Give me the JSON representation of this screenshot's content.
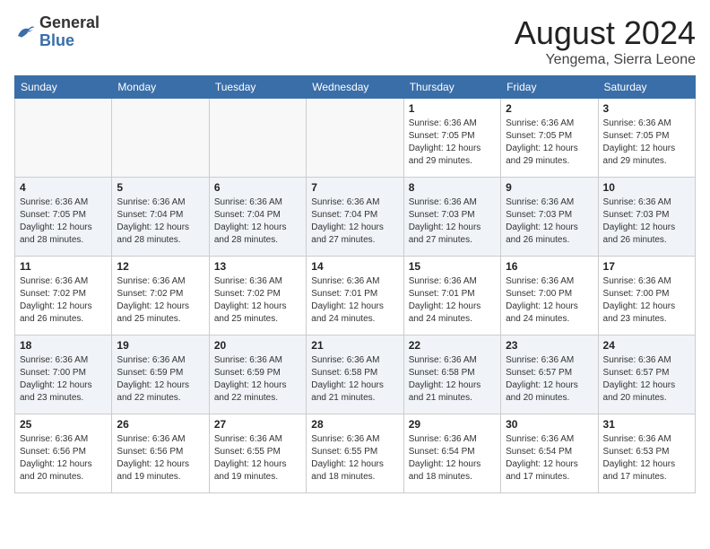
{
  "header": {
    "logo_general": "General",
    "logo_blue": "Blue",
    "month_title": "August 2024",
    "location": "Yengema, Sierra Leone"
  },
  "weekdays": [
    "Sunday",
    "Monday",
    "Tuesday",
    "Wednesday",
    "Thursday",
    "Friday",
    "Saturday"
  ],
  "weeks": [
    [
      {
        "day": "",
        "info": ""
      },
      {
        "day": "",
        "info": ""
      },
      {
        "day": "",
        "info": ""
      },
      {
        "day": "",
        "info": ""
      },
      {
        "day": "1",
        "info": "Sunrise: 6:36 AM\nSunset: 7:05 PM\nDaylight: 12 hours\nand 29 minutes."
      },
      {
        "day": "2",
        "info": "Sunrise: 6:36 AM\nSunset: 7:05 PM\nDaylight: 12 hours\nand 29 minutes."
      },
      {
        "day": "3",
        "info": "Sunrise: 6:36 AM\nSunset: 7:05 PM\nDaylight: 12 hours\nand 29 minutes."
      }
    ],
    [
      {
        "day": "4",
        "info": "Sunrise: 6:36 AM\nSunset: 7:05 PM\nDaylight: 12 hours\nand 28 minutes."
      },
      {
        "day": "5",
        "info": "Sunrise: 6:36 AM\nSunset: 7:04 PM\nDaylight: 12 hours\nand 28 minutes."
      },
      {
        "day": "6",
        "info": "Sunrise: 6:36 AM\nSunset: 7:04 PM\nDaylight: 12 hours\nand 28 minutes."
      },
      {
        "day": "7",
        "info": "Sunrise: 6:36 AM\nSunset: 7:04 PM\nDaylight: 12 hours\nand 27 minutes."
      },
      {
        "day": "8",
        "info": "Sunrise: 6:36 AM\nSunset: 7:03 PM\nDaylight: 12 hours\nand 27 minutes."
      },
      {
        "day": "9",
        "info": "Sunrise: 6:36 AM\nSunset: 7:03 PM\nDaylight: 12 hours\nand 26 minutes."
      },
      {
        "day": "10",
        "info": "Sunrise: 6:36 AM\nSunset: 7:03 PM\nDaylight: 12 hours\nand 26 minutes."
      }
    ],
    [
      {
        "day": "11",
        "info": "Sunrise: 6:36 AM\nSunset: 7:02 PM\nDaylight: 12 hours\nand 26 minutes."
      },
      {
        "day": "12",
        "info": "Sunrise: 6:36 AM\nSunset: 7:02 PM\nDaylight: 12 hours\nand 25 minutes."
      },
      {
        "day": "13",
        "info": "Sunrise: 6:36 AM\nSunset: 7:02 PM\nDaylight: 12 hours\nand 25 minutes."
      },
      {
        "day": "14",
        "info": "Sunrise: 6:36 AM\nSunset: 7:01 PM\nDaylight: 12 hours\nand 24 minutes."
      },
      {
        "day": "15",
        "info": "Sunrise: 6:36 AM\nSunset: 7:01 PM\nDaylight: 12 hours\nand 24 minutes."
      },
      {
        "day": "16",
        "info": "Sunrise: 6:36 AM\nSunset: 7:00 PM\nDaylight: 12 hours\nand 24 minutes."
      },
      {
        "day": "17",
        "info": "Sunrise: 6:36 AM\nSunset: 7:00 PM\nDaylight: 12 hours\nand 23 minutes."
      }
    ],
    [
      {
        "day": "18",
        "info": "Sunrise: 6:36 AM\nSunset: 7:00 PM\nDaylight: 12 hours\nand 23 minutes."
      },
      {
        "day": "19",
        "info": "Sunrise: 6:36 AM\nSunset: 6:59 PM\nDaylight: 12 hours\nand 22 minutes."
      },
      {
        "day": "20",
        "info": "Sunrise: 6:36 AM\nSunset: 6:59 PM\nDaylight: 12 hours\nand 22 minutes."
      },
      {
        "day": "21",
        "info": "Sunrise: 6:36 AM\nSunset: 6:58 PM\nDaylight: 12 hours\nand 21 minutes."
      },
      {
        "day": "22",
        "info": "Sunrise: 6:36 AM\nSunset: 6:58 PM\nDaylight: 12 hours\nand 21 minutes."
      },
      {
        "day": "23",
        "info": "Sunrise: 6:36 AM\nSunset: 6:57 PM\nDaylight: 12 hours\nand 20 minutes."
      },
      {
        "day": "24",
        "info": "Sunrise: 6:36 AM\nSunset: 6:57 PM\nDaylight: 12 hours\nand 20 minutes."
      }
    ],
    [
      {
        "day": "25",
        "info": "Sunrise: 6:36 AM\nSunset: 6:56 PM\nDaylight: 12 hours\nand 20 minutes."
      },
      {
        "day": "26",
        "info": "Sunrise: 6:36 AM\nSunset: 6:56 PM\nDaylight: 12 hours\nand 19 minutes."
      },
      {
        "day": "27",
        "info": "Sunrise: 6:36 AM\nSunset: 6:55 PM\nDaylight: 12 hours\nand 19 minutes."
      },
      {
        "day": "28",
        "info": "Sunrise: 6:36 AM\nSunset: 6:55 PM\nDaylight: 12 hours\nand 18 minutes."
      },
      {
        "day": "29",
        "info": "Sunrise: 6:36 AM\nSunset: 6:54 PM\nDaylight: 12 hours\nand 18 minutes."
      },
      {
        "day": "30",
        "info": "Sunrise: 6:36 AM\nSunset: 6:54 PM\nDaylight: 12 hours\nand 17 minutes."
      },
      {
        "day": "31",
        "info": "Sunrise: 6:36 AM\nSunset: 6:53 PM\nDaylight: 12 hours\nand 17 minutes."
      }
    ]
  ]
}
